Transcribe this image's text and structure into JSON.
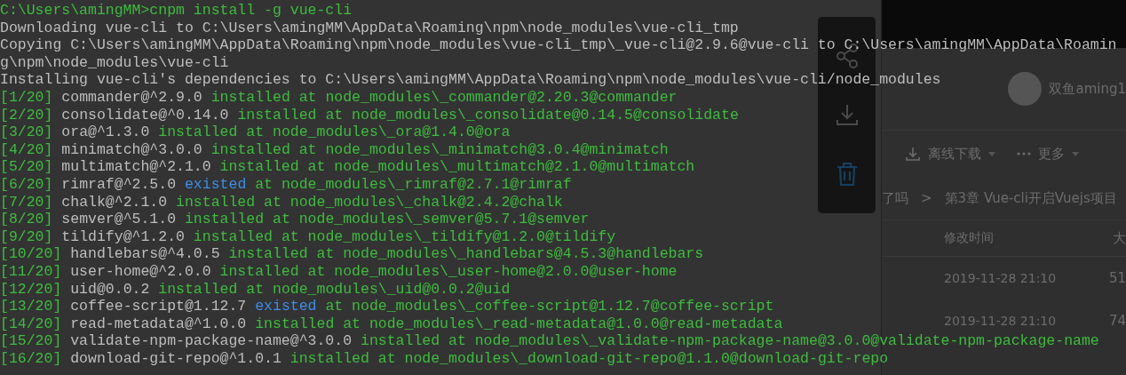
{
  "terminal": {
    "lines": [
      {
        "kind": "command",
        "text": "C:\\Users\\amingMM>cnpm install -g vue-cli"
      },
      {
        "kind": "output",
        "text": "Downloading vue-cli to C:\\Users\\amingMM\\AppData\\Roaming\\npm\\node_modules\\vue-cli_tmp"
      },
      {
        "kind": "output",
        "text": "Copying C:\\Users\\amingMM\\AppData\\Roaming\\npm\\node_modules\\vue-cli_tmp\\_vue-cli@2.9.6@vue-cli to C:\\Users\\amingMM\\AppData\\Roamin"
      },
      {
        "kind": "output",
        "text": "g\\npm\\node_modules\\vue-cli"
      },
      {
        "kind": "output",
        "text": "Installing vue-cli's dependencies to C:\\Users\\amingMM\\AppData\\Roaming\\npm\\node_modules\\vue-cli/node_modules"
      },
      {
        "kind": "progress",
        "step": "[1/20]",
        "package": "commander@^2.9.0",
        "status": "installed",
        "existed": false,
        "location": "at node_modules\\_commander@2.20.3@commander"
      },
      {
        "kind": "progress",
        "step": "[2/20]",
        "package": "consolidate@^0.14.0",
        "status": "installed",
        "existed": false,
        "location": "at node_modules\\_consolidate@0.14.5@consolidate"
      },
      {
        "kind": "progress",
        "step": "[3/20]",
        "package": "ora@^1.3.0",
        "status": "installed",
        "existed": false,
        "location": "at node_modules\\_ora@1.4.0@ora"
      },
      {
        "kind": "progress",
        "step": "[4/20]",
        "package": "minimatch@^3.0.0",
        "status": "installed",
        "existed": false,
        "location": "at node_modules\\_minimatch@3.0.4@minimatch"
      },
      {
        "kind": "progress",
        "step": "[5/20]",
        "package": "multimatch@^2.1.0",
        "status": "installed",
        "existed": false,
        "location": "at node_modules\\_multimatch@2.1.0@multimatch"
      },
      {
        "kind": "progress",
        "step": "[6/20]",
        "package": "rimraf@^2.5.0",
        "status": "existed",
        "existed": true,
        "location": "at node_modules\\_rimraf@2.7.1@rimraf"
      },
      {
        "kind": "progress",
        "step": "[7/20]",
        "package": "chalk@^2.1.0",
        "status": "installed",
        "existed": false,
        "location": "at node_modules\\_chalk@2.4.2@chalk"
      },
      {
        "kind": "progress",
        "step": "[8/20]",
        "package": "semver@^5.1.0",
        "status": "installed",
        "existed": false,
        "location": "at node_modules\\_semver@5.7.1@semver"
      },
      {
        "kind": "progress",
        "step": "[9/20]",
        "package": "tildify@^1.2.0",
        "status": "installed",
        "existed": false,
        "location": "at node_modules\\_tildify@1.2.0@tildify"
      },
      {
        "kind": "progress",
        "step": "[10/20]",
        "package": "handlebars@^4.0.5",
        "status": "installed",
        "existed": false,
        "location": "at node_modules\\_handlebars@4.5.3@handlebars"
      },
      {
        "kind": "progress",
        "step": "[11/20]",
        "package": "user-home@^2.0.0",
        "status": "installed",
        "existed": false,
        "location": "at node_modules\\_user-home@2.0.0@user-home"
      },
      {
        "kind": "progress",
        "step": "[12/20]",
        "package": "uid@0.0.2",
        "status": "installed",
        "existed": false,
        "location": "at node_modules\\_uid@0.0.2@uid"
      },
      {
        "kind": "progress",
        "step": "[13/20]",
        "package": "coffee-script@1.12.7",
        "status": "existed",
        "existed": true,
        "location": "at node_modules\\_coffee-script@1.12.7@coffee-script"
      },
      {
        "kind": "progress",
        "step": "[14/20]",
        "package": "read-metadata@^1.0.0",
        "status": "installed",
        "existed": false,
        "location": "at node_modules\\_read-metadata@1.0.0@read-metadata"
      },
      {
        "kind": "progress",
        "step": "[15/20]",
        "package": "validate-npm-package-name@^3.0.0",
        "status": "installed",
        "existed": false,
        "location": "at node_modules\\_validate-npm-package-name@3.0.0@validate-npm-package-name"
      },
      {
        "kind": "progress",
        "step": "[16/20]",
        "package": "download-git-repo@^1.0.1",
        "status": "installed",
        "existed": false,
        "location": "at node_modules\\_download-git-repo@1.1.0@download-git-repo"
      }
    ]
  },
  "file_panel": {
    "user_name": "双鱼aming1",
    "toolbar": [
      {
        "label": "离线下载"
      },
      {
        "label": "更多"
      }
    ],
    "breadcrumb": {
      "items": [
        "了吗",
        "第3章 Vue-cli开启Vuejs项目"
      ],
      "separator": ">"
    },
    "columns": [
      "修改时间",
      "大"
    ],
    "rows": [
      {
        "modified": "2019-11-28 21:10",
        "size": "51"
      },
      {
        "modified": "2019-11-28 21:10",
        "size": "74"
      }
    ]
  }
}
